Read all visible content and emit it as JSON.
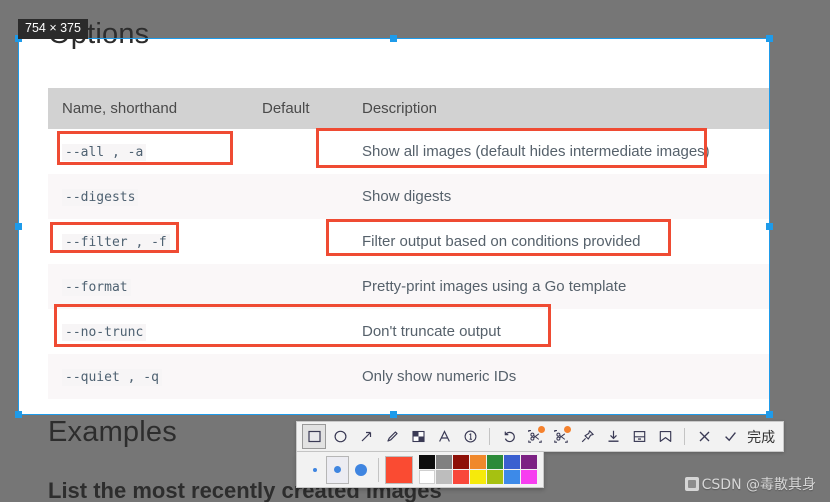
{
  "doc": {
    "heading_options": "Options",
    "heading_examples": "Examples",
    "examples_sub": "List the most recently created images",
    "table": {
      "headers": [
        "Name, shorthand",
        "Default",
        "Description"
      ],
      "rows": [
        {
          "name": "--all , -a",
          "default": "",
          "description": "Show all images (default hides intermediate images)"
        },
        {
          "name": "--digests",
          "default": "",
          "description": "Show digests"
        },
        {
          "name": "--filter , -f",
          "default": "",
          "description": "Filter output based on conditions provided"
        },
        {
          "name": "--format",
          "default": "",
          "description": "Pretty-print images using a Go template"
        },
        {
          "name": "--no-trunc",
          "default": "",
          "description": "Don't truncate output"
        },
        {
          "name": "--quiet , -q",
          "default": "",
          "description": "Only show numeric IDs"
        }
      ]
    }
  },
  "capture": {
    "size_badge": "754 × 375",
    "selection_color": "#1e9bea",
    "annotation_color": "#ef4b33",
    "annotations": [
      {
        "label": "all-flag-name"
      },
      {
        "label": "all-flag-description"
      },
      {
        "label": "filter-flag-name"
      },
      {
        "label": "filter-flag-description"
      },
      {
        "label": "no-trunc-row"
      }
    ]
  },
  "toolbar": {
    "tools": [
      {
        "name": "rectangle-tool",
        "selected": true,
        "badge": false
      },
      {
        "name": "ellipse-tool",
        "selected": false,
        "badge": false
      },
      {
        "name": "arrow-tool",
        "selected": false,
        "badge": false
      },
      {
        "name": "pen-tool",
        "selected": false,
        "badge": false
      },
      {
        "name": "mosaic-tool",
        "selected": false,
        "badge": false
      },
      {
        "name": "text-tool",
        "selected": false,
        "badge": false
      },
      {
        "name": "number-tool",
        "selected": false,
        "badge": false
      },
      {
        "name": "undo-tool",
        "selected": false,
        "badge": false
      },
      {
        "name": "ocr-tool",
        "selected": false,
        "badge": true
      },
      {
        "name": "translate-tool",
        "selected": false,
        "badge": true
      },
      {
        "name": "pin-tool",
        "selected": false,
        "badge": false
      },
      {
        "name": "download-tool",
        "selected": false,
        "badge": false
      },
      {
        "name": "save-tool",
        "selected": false,
        "badge": false
      },
      {
        "name": "bookmark-tool",
        "selected": false,
        "badge": false
      },
      {
        "name": "cancel-tool",
        "selected": false,
        "badge": false
      },
      {
        "name": "confirm-tool",
        "selected": false,
        "badge": false
      }
    ],
    "done_label": "完成"
  },
  "palette": {
    "sizes": [
      "small",
      "medium",
      "large"
    ],
    "selected_size": "medium",
    "active_color": "#fa4b32",
    "swatches_row1": [
      "#0d0d0d",
      "#808080",
      "#8e1007",
      "#f0882c",
      "#2c8a39",
      "#3a5fd0",
      "#7c2183",
      "#0a8e99"
    ],
    "swatches_row2": [
      "#ffffff",
      "#bdbdbd",
      "#f9473a",
      "#f6ea0b",
      "#a6c111",
      "#3d8ae8",
      "#f73ef0",
      "#2fd9d0"
    ]
  },
  "watermark": {
    "text": "CSDN @毒散其身"
  }
}
